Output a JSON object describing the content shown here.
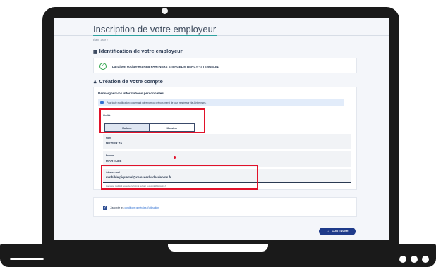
{
  "page": {
    "title": "Inscription de votre employeur",
    "step": "Étape 1 sur 2"
  },
  "employer_section": {
    "heading": "Identification de votre employeur",
    "heading_icon": "building-icon",
    "confirmation": "La raison sociale est F&B PARTNERS STENGELIN BERCY - STENGELIN."
  },
  "account_section": {
    "heading": "Création de votre compte",
    "heading_icon": "person-icon",
    "subheading": "Renseigner vos informations personnelles",
    "info_banner": "Pour toute modification concernant votre nom ou prénom, merci de vous rendre sur Net-Entreprises."
  },
  "form": {
    "civility": {
      "label": "Civilité",
      "options": [
        "Madame",
        "Monsieur"
      ],
      "selected": "Madame"
    },
    "last_name": {
      "label": "Nom",
      "value": "METIER TA"
    },
    "first_name": {
      "label": "Prénom",
      "value": "MATHILDE"
    },
    "email": {
      "label": "Adresse mail",
      "value": "mathilde.piquemal@caisseschadesdepots.fr",
      "hint": "L'adresse mail doit respecter le format suivant : exemple@domaine.fr"
    },
    "terms": {
      "prefix": "J'accepte les",
      "link": "conditions générales d'utilisation"
    }
  },
  "actions": {
    "continue_label": "CONTINUER"
  },
  "colors": {
    "accent": "#2fa3a0",
    "primary": "#1e3a8a",
    "highlight": "#e1122a",
    "success": "#2fa34a"
  }
}
